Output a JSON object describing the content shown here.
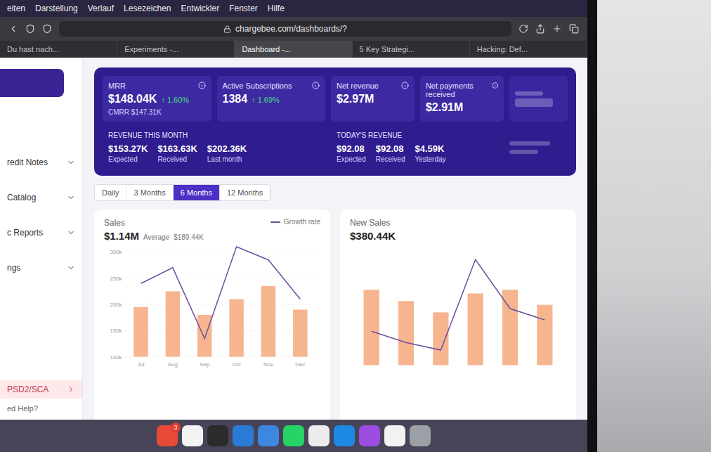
{
  "menu_bar": {
    "items": [
      "eiten",
      "Darstellung",
      "Verlauf",
      "Lesezeichen",
      "Entwickler",
      "Fenster",
      "Hilfe"
    ]
  },
  "address_bar": {
    "url": "chargebee.com/dashboards/?"
  },
  "browser_tabs": [
    {
      "label": "Du hast nach...",
      "selected": false
    },
    {
      "label": "Experiments -...",
      "selected": false
    },
    {
      "label": "Dashboard -...",
      "selected": true
    },
    {
      "label": "5 Key Strategi...",
      "selected": false
    },
    {
      "label": "Hacking: Def...",
      "selected": false
    }
  ],
  "sidebar": {
    "items": [
      {
        "label": "redit Notes",
        "selected": false,
        "expanded": false
      },
      {
        "label": "Catalog",
        "selected": false,
        "expanded": false
      },
      {
        "label": "c Reports",
        "selected": false,
        "expanded": false
      },
      {
        "label": "ngs",
        "selected": false,
        "expanded": false
      },
      {
        "label": "PSD2/SCA",
        "selected": true,
        "expanded": false
      }
    ],
    "help": "ed Help?"
  },
  "metrics": [
    {
      "label": "MRR",
      "value": "$148.04K",
      "change": "↑ 1.60%",
      "sub": "CMRR $147.31K"
    },
    {
      "label": "Active Subscriptions",
      "value": "1384",
      "change": "↑ 1.69%",
      "sub": ""
    },
    {
      "label": "Net revenue",
      "value": "$2.97M",
      "change": "",
      "sub": ""
    },
    {
      "label": "Net payments received",
      "value": "$2.91M",
      "change": "",
      "sub": ""
    }
  ],
  "revenue_this_month": {
    "title": "REVENUE THIS MONTH",
    "items": [
      {
        "value": "$153.27K",
        "label": "Expected"
      },
      {
        "value": "$163.63K",
        "label": "Received"
      },
      {
        "value": "$202.36K",
        "label": "Last month"
      }
    ]
  },
  "todays_revenue": {
    "title": "TODAY'S REVENUE",
    "items": [
      {
        "value": "$92.08",
        "label": "Expected"
      },
      {
        "value": "$92.08",
        "label": "Received"
      },
      {
        "value": "$4.59K",
        "label": "Yesterday"
      }
    ]
  },
  "range_tabs": [
    {
      "label": "Daily",
      "selected": false
    },
    {
      "label": "3 Months",
      "selected": false
    },
    {
      "label": "6 Months",
      "selected": true
    },
    {
      "label": "12 Months",
      "selected": false
    }
  ],
  "sales_chart": {
    "title": "Sales",
    "total": "$1.14M",
    "average_label": "Average",
    "average": "$189.44K",
    "legend": "Growth rate",
    "y_ticks": [
      "300k",
      "250k",
      "200k",
      "150k",
      "100k"
    ],
    "x_labels": [
      "Jul",
      "Aug",
      "Sep",
      "Oct",
      "Nov",
      "Dec"
    ],
    "bars": [
      195,
      225,
      180,
      210,
      235,
      190
    ],
    "line": [
      240,
      270,
      135,
      310,
      285,
      210
    ]
  },
  "new_sales_chart": {
    "title": "New Sales",
    "total": "$380.44K",
    "bars": [
      300,
      270,
      240,
      290,
      300,
      260
    ],
    "line": [
      190,
      160,
      140,
      380,
      250,
      220
    ]
  },
  "dock": {
    "badge": "3"
  }
}
